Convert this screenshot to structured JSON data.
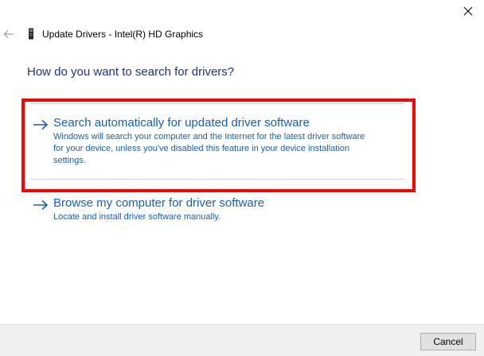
{
  "window": {
    "title": "Update Drivers - Intel(R) HD Graphics"
  },
  "heading": "How do you want to search for drivers?",
  "options": [
    {
      "title": "Search automatically for updated driver software",
      "description_lines": [
        "Windows will search your computer and the Internet for the latest driver software",
        "for your device, unless you've disabled this feature in your device installation",
        "settings."
      ],
      "icon": "arrow-right-icon"
    },
    {
      "title": "Browse my computer for driver software",
      "description_lines": [
        "Locate and install driver software manually."
      ],
      "icon": "arrow-right-icon"
    }
  ],
  "footer": {
    "cancel_label": "Cancel"
  },
  "colors": {
    "heading": "#1e3287",
    "link": "#1760b0",
    "highlight": "#ff0000",
    "footer_bg": "#f0f0f0"
  }
}
